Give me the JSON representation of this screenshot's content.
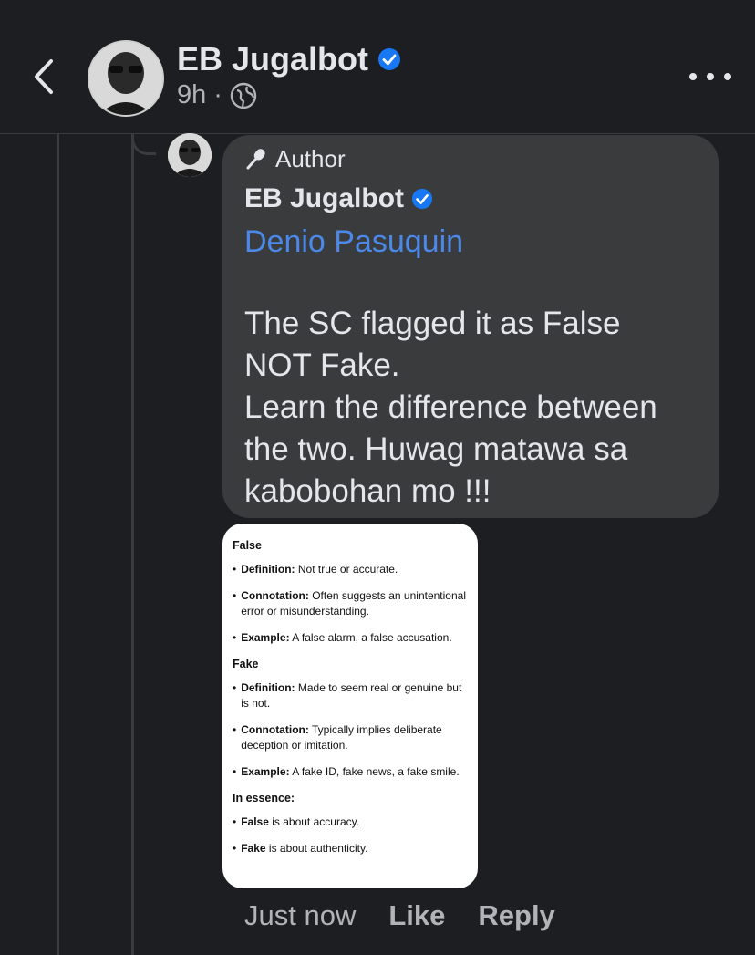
{
  "header": {
    "page_name": "EB Jugalbot",
    "time": "9h",
    "separator": "·",
    "icons": {
      "back": "chevron-left-icon",
      "verified": "verified-badge-icon",
      "audience": "globe-icon",
      "more": "more-dots-icon"
    }
  },
  "comment": {
    "author_badge": "Author",
    "commenter_name": "EB Jugalbot",
    "mention": "Denio Pasuquin",
    "text": "The SC flagged it as False\nNOT Fake.\nLearn the difference between\nthe two. Huwag matawa sa\nkabobohan mo !!!",
    "attachment": {
      "sections": [
        {
          "heading": "False",
          "items": [
            {
              "term": "Definition:",
              "text": "Not true or accurate."
            },
            {
              "term": "Connotation:",
              "text": "Often suggests an unintentional error or misunderstanding."
            },
            {
              "term": "Example:",
              "text": "A false alarm, a false accusation."
            }
          ]
        },
        {
          "heading": "Fake",
          "items": [
            {
              "term": "Definition:",
              "text": "Made to seem real or genuine but is not."
            },
            {
              "term": "Connotation:",
              "text": "Typically implies deliberate deception or imitation."
            },
            {
              "term": "Example:",
              "text": "A fake ID, fake news, a fake smile."
            }
          ]
        },
        {
          "heading": "In essence:",
          "items": [
            {
              "term": "False",
              "text": "is about accuracy."
            },
            {
              "term": "Fake",
              "text": "is about authenticity."
            }
          ]
        }
      ]
    },
    "timestamp": "Just now",
    "like_label": "Like",
    "reply_label": "Reply"
  },
  "colors": {
    "background": "#1c1e21",
    "bubble": "#3a3b3c",
    "mention": "#4b88e8",
    "verified": "#1877f2"
  }
}
